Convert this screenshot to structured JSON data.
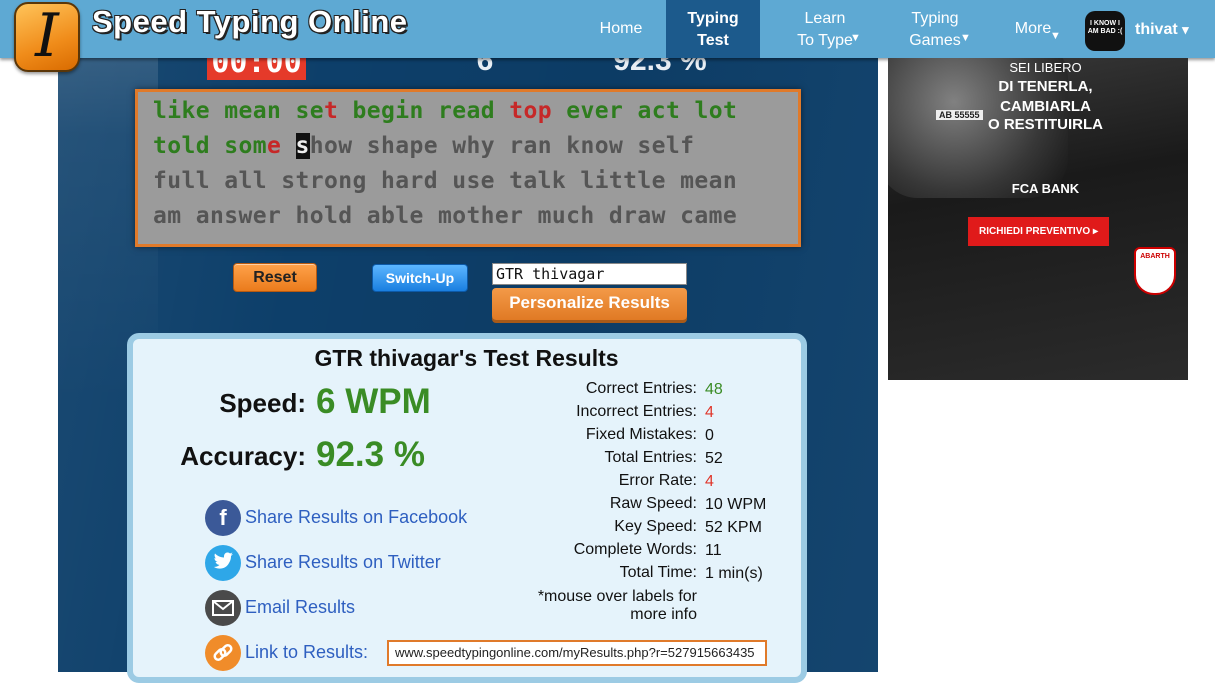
{
  "header": {
    "logo_glyph": "I",
    "site_name": "Speed Typing Online",
    "nav": {
      "home": "Home",
      "typing_line1": "Typing",
      "typing_line2": "Test",
      "learn_line1": "Learn",
      "learn_line2": "To Type",
      "games_line1": "Typing",
      "games_line2": "Games",
      "more": "More",
      "caret": "▼"
    },
    "avatar_text": "I KNOW I AM BAD :(",
    "username": "thivat",
    "user_caret": "▾"
  },
  "stats_bar": {
    "timer": "00:00",
    "wpm": "6",
    "accuracy": "92.3 %"
  },
  "typing_text": {
    "line1": [
      {
        "t": "like",
        "s": "ok"
      },
      {
        "t": " ",
        "s": "ok"
      },
      {
        "t": "mean",
        "s": "ok"
      },
      {
        "t": " ",
        "s": "ok"
      },
      {
        "t": "se",
        "s": "ok"
      },
      {
        "t": "t",
        "s": "err"
      },
      {
        "t": " ",
        "s": "ok"
      },
      {
        "t": "begin",
        "s": "ok"
      },
      {
        "t": " ",
        "s": "ok"
      },
      {
        "t": "read",
        "s": "ok"
      },
      {
        "t": " ",
        "s": "ok"
      },
      {
        "t": "top",
        "s": "err"
      },
      {
        "t": " ",
        "s": "ok"
      },
      {
        "t": "ever",
        "s": "ok"
      },
      {
        "t": " ",
        "s": "ok"
      },
      {
        "t": "act",
        "s": "ok"
      },
      {
        "t": " ",
        "s": "ok"
      },
      {
        "t": "lot",
        "s": "ok"
      }
    ],
    "line2": [
      {
        "t": "told",
        "s": "ok"
      },
      {
        "t": " ",
        "s": "ok"
      },
      {
        "t": "som",
        "s": "ok"
      },
      {
        "t": "e",
        "s": "err"
      },
      {
        "t": " ",
        "s": "ok"
      },
      {
        "t": "s",
        "s": "cursor"
      },
      {
        "t": "how shape why ran know self",
        "s": "up"
      }
    ],
    "line3": "full all strong hard use talk little mean",
    "line4": "am answer hold able mother much draw came"
  },
  "controls": {
    "reset": "Reset",
    "switch_up": "Switch-Up",
    "name_value": "GTR thivagar",
    "personalize": "Personalize Results"
  },
  "results": {
    "title": "GTR thivagar's Test Results",
    "speed_label": "Speed:",
    "speed_value": "6 WPM",
    "accuracy_label": "Accuracy:",
    "accuracy_value": "92.3 %",
    "share": {
      "facebook": "Share Results on Facebook",
      "twitter": "Share Results on Twitter",
      "email": "Email Results",
      "link": "Link to Results:"
    },
    "link_url": "www.speedtypingonline.com/myResults.php?r=527915663435",
    "stats": [
      {
        "label": "Correct Entries:",
        "value": "48",
        "color": "green"
      },
      {
        "label": "Incorrect Entries:",
        "value": "4",
        "color": "red"
      },
      {
        "label": "Fixed Mistakes:",
        "value": "0",
        "color": ""
      },
      {
        "label": "Total Entries:",
        "value": "52",
        "color": ""
      },
      {
        "label": "Error Rate:",
        "value": "4",
        "color": "red"
      },
      {
        "label": "Raw Speed:",
        "value": "10 WPM",
        "color": ""
      },
      {
        "label": "Key Speed:",
        "value": "52 KPM",
        "color": ""
      },
      {
        "label": "Complete Words:",
        "value": "11",
        "color": ""
      },
      {
        "label": "Total Time:",
        "value": "1 min(s)",
        "color": ""
      }
    ],
    "note_line1": "*mouse over labels for",
    "note_line2": "more info"
  },
  "ad": {
    "line1": "SEI LIBERO",
    "line2": "DI TENERLA,",
    "line3": "CAMBIARLA",
    "line4": "O RESTITUIRLA",
    "brand": "FCA BANK",
    "button": "RICHIEDI PREVENTIVO ▸",
    "badge": "ABARTH",
    "plate": "AB 55555"
  }
}
